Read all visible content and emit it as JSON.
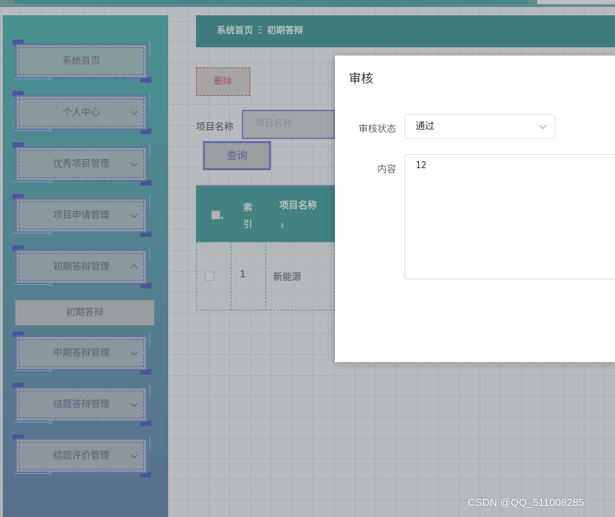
{
  "sidebar": {
    "items": [
      {
        "label": "系统首页",
        "has_chevron": false
      },
      {
        "label": "个人中心",
        "has_chevron": true,
        "chevron": "down"
      },
      {
        "label": "优秀项目管理",
        "has_chevron": true,
        "chevron": "down"
      },
      {
        "label": "项目申请管理",
        "has_chevron": true,
        "chevron": "down"
      },
      {
        "label": "初期答辩管理",
        "has_chevron": true,
        "chevron": "up"
      },
      {
        "label": "中期答辩管理",
        "has_chevron": true,
        "chevron": "down"
      },
      {
        "label": "结题答辩管理",
        "has_chevron": true,
        "chevron": "down"
      },
      {
        "label": "结题评价管理",
        "has_chevron": true,
        "chevron": "down"
      }
    ],
    "submenu": {
      "label": "初期答辩"
    }
  },
  "breadcrumb": {
    "home": "系统首页",
    "separator": "Ξ",
    "current": "初期答辩"
  },
  "toolbar": {
    "delete_label": "删除"
  },
  "search": {
    "label": "项目名称",
    "placeholder": "项目名称",
    "query_label": "查询"
  },
  "table": {
    "headers": {
      "index": "索引",
      "name": "项目名称",
      "sort_icon": "sort-icon"
    },
    "rows": [
      {
        "index": "1",
        "name": "新能源"
      }
    ]
  },
  "dialog": {
    "title": "审核",
    "status_label": "审核状态",
    "status_value": "通过",
    "content_label": "内容",
    "content_value": "12"
  },
  "watermark": "CSDN @QQ_511008285",
  "colors": {
    "sidebar_top": "#2aa39c",
    "sidebar_bottom": "#4a6d9b",
    "breadcrumb_bg": "#1a7f7a",
    "accent_blue": "#5a6cc8",
    "danger": "#c0392b"
  }
}
